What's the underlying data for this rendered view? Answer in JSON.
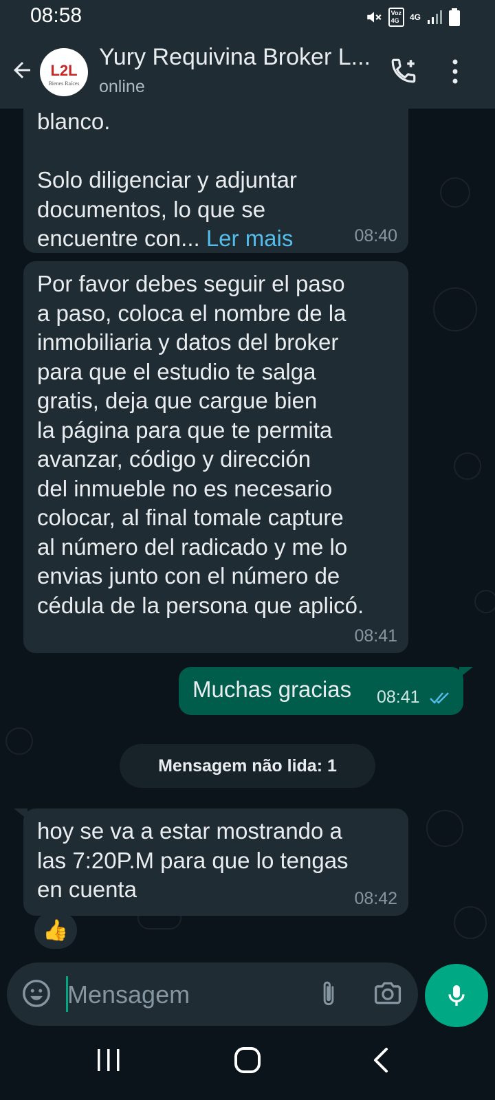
{
  "status_bar": {
    "time": "08:58",
    "volte_label": "Voz\n4G",
    "network_label": "4G"
  },
  "header": {
    "contact_name": "Yury Requivina Broker L...",
    "presence": "online",
    "avatar_logo_text": "L2L",
    "avatar_subtitle": "Bienes Raíces"
  },
  "messages": [
    {
      "direction": "incoming",
      "text": "blanco.\n\nSolo diligenciar y adjuntar\ndocumentos, lo que se\nencuentre con... ",
      "read_more": "Ler mais",
      "time": "08:40"
    },
    {
      "direction": "incoming",
      "text": "Por favor debes seguir el paso\na paso, coloca el nombre de la\ninmobiliaria y datos del broker\npara que el estudio te salga\ngratis, deja que cargue bien\nla página para que te permita\navanzar, código y dirección\ndel inmueble no es necesario\ncolocar, al final tomale capture\nal número del radicado y me lo\nenvias junto con el número de\ncédula de la persona que aplicó.",
      "time": "08:41"
    },
    {
      "direction": "outgoing",
      "text": "Muchas gracias",
      "time": "08:41",
      "status_icon": "double-check-read"
    },
    {
      "direction": "incoming",
      "text": "hoy se va a estar mostrando a\nlas 7:20P.M para que lo tengas\nen cuenta",
      "time": "08:42",
      "reaction": "👍"
    }
  ],
  "unread_divider": "Mensagem não lida: 1",
  "composer": {
    "placeholder": "Mensagem"
  },
  "colors": {
    "background": "#0b141a",
    "header": "#1f2c34",
    "incoming_bubble": "#202c33",
    "outgoing_bubble": "#005c4b",
    "accent": "#00a884",
    "link": "#53bdeb"
  },
  "icons": [
    "back-arrow-icon",
    "add-call-icon",
    "more-vert-icon",
    "emoji-icon",
    "attach-icon",
    "camera-icon",
    "mic-icon",
    "recents-icon",
    "home-icon",
    "nav-back-icon"
  ]
}
